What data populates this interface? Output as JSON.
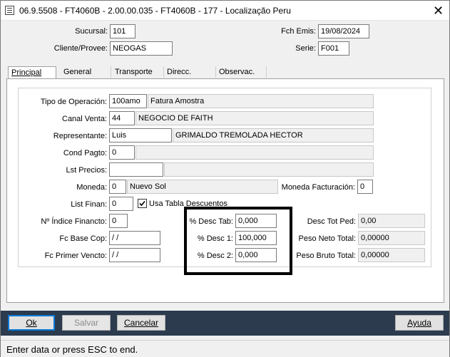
{
  "window": {
    "title": "06.9.5508 - FT4060B - 2.00.00.035 - FT4060B - 177 - Localização Peru",
    "close_glyph": "✕"
  },
  "header": {
    "sucursal_label": "Sucursal:",
    "sucursal_value": "101",
    "cliente_label": "Cliente/Provee:",
    "cliente_value": "NEOGAS",
    "fch_emis_label": "Fch Emis:",
    "fch_emis_value": "19/08/2024",
    "serie_label": "Serie:",
    "serie_value": "F001"
  },
  "tabs": [
    {
      "label": "Principal",
      "active": true
    },
    {
      "label": "General",
      "active": false
    },
    {
      "label": "Transporte",
      "active": false
    },
    {
      "label": "Direcc.",
      "active": false
    },
    {
      "label": "Observac.",
      "active": false
    }
  ],
  "form": {
    "tipo_operacion_label": "Tipo de Operación:",
    "tipo_operacion_code": "100amo",
    "tipo_operacion_desc": "Fatura Amostra",
    "canal_venta_label": "Canal Venta:",
    "canal_venta_code": "44",
    "canal_venta_desc": "NEGOCIO DE FAITH",
    "representante_label": "Representante:",
    "representante_code": "Luis",
    "representante_desc": "GRIMALDO TREMOLADA HECTOR",
    "cond_pagto_label": "Cond Pagto:",
    "cond_pagto_code": "0",
    "cond_pagto_desc": "",
    "lst_precios_label": "Lst Precios:",
    "lst_precios_code": "",
    "lst_precios_desc": "",
    "moneda_label": "Moneda:",
    "moneda_code": "0",
    "moneda_desc": "Nuevo Sol",
    "moneda_fact_label": "Moneda Facturación:",
    "moneda_fact_value": "0",
    "list_finan_label": "List Finan:",
    "list_finan_value": "0",
    "usa_tabla_label": "Usa Tabla Descuentos",
    "usa_tabla_checked": true,
    "indice_label": "Nº Índice Financto:",
    "indice_value": "0",
    "fc_base_label": "Fc Base Cop:",
    "fc_base_value": " / /",
    "fc_primer_label": "Fc Primer Vencto:",
    "fc_primer_value": " / /",
    "desc_tab_label": "% Desc Tab:",
    "desc_tab_value": "0,000",
    "desc1_label": "% Desc 1:",
    "desc1_value": "100,000",
    "desc2_label": "% Desc 2:",
    "desc2_value": "0,000",
    "desc_tot_label": "Desc Tot Ped:",
    "desc_tot_value": "0,00",
    "peso_neto_label": "Peso Neto Total:",
    "peso_neto_value": "0,00000",
    "peso_bruto_label": "Peso Bruto Total:",
    "peso_bruto_value": "0,00000"
  },
  "buttons": {
    "ok": "Ok",
    "salvar": "Salvar",
    "cancelar": "Cancelar",
    "ayuda": "Ayuda"
  },
  "status": {
    "text": "Enter data or press ESC to end."
  },
  "colors": {
    "button_bar": "#2c3b4e",
    "default_button_border": "#0078d7",
    "highlight_box": "#000000"
  }
}
